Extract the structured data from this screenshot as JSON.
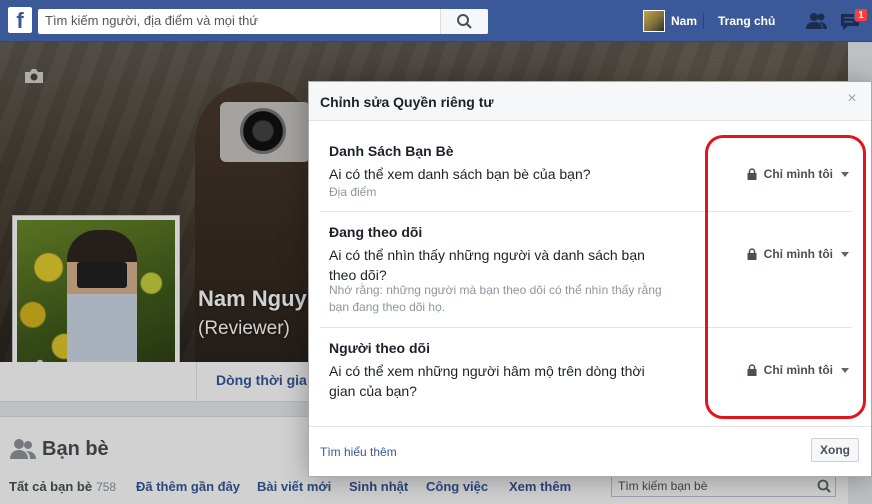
{
  "topbar": {
    "logo": "f",
    "search_placeholder": "Tìm kiếm người, địa điểm và mọi thứ",
    "user_name": "Nam",
    "home_label": "Trang chủ",
    "notification_count": "1"
  },
  "profile": {
    "name": "Nam Nguy",
    "subtitle": "(Reviewer)",
    "timeline_tab": "Dòng thời gia"
  },
  "friends": {
    "title": "Bạn bè",
    "tabs": [
      {
        "label": "Tất cả bạn bè",
        "count": "758"
      },
      {
        "label": "Đã thêm gần đây"
      },
      {
        "label": "Bài viết mới"
      },
      {
        "label": "Sinh nhật"
      },
      {
        "label": "Công việc"
      },
      {
        "label": "Xem thêm"
      }
    ],
    "search_placeholder": "Tìm kiếm bạn bè"
  },
  "dialog": {
    "title": "Chỉnh sửa Quyền riêng tư",
    "close": "×",
    "rows": [
      {
        "title": "Danh Sách Bạn Bè",
        "question": "Ai có thể xem danh sách bạn bè của bạn?",
        "note": "Địa điểm",
        "privacy": "Chỉ mình tôi"
      },
      {
        "title": "Đang theo dõi",
        "question": "Ai có thể nhìn thấy những người và danh sách bạn theo dõi?",
        "note": "Nhớ rằng: những người mà bạn theo dõi có thể nhìn thấy rằng bạn đang theo dõi họ.",
        "privacy": "Chỉ mình tôi"
      },
      {
        "title": "Người theo dõi",
        "question": "Ai có thể xem những người hâm mộ trên dòng thời gian của bạn?",
        "privacy": "Chỉ mình tôi"
      }
    ],
    "learn_more": "Tìm hiểu thêm",
    "done": "Xong"
  },
  "colors": {
    "brand": "#3b5998",
    "link": "#365899",
    "highlight": "#e2141c"
  }
}
